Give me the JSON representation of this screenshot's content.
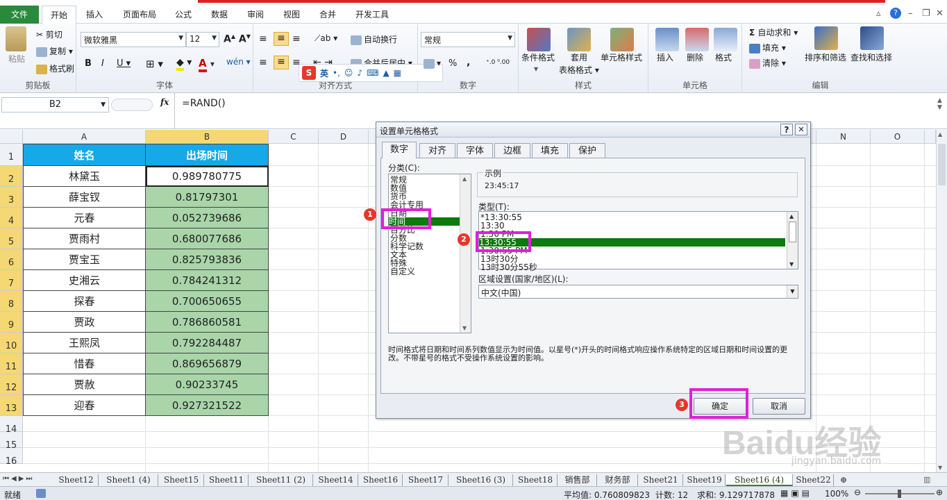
{
  "tabs": [
    "文件",
    "开始",
    "插入",
    "页面布局",
    "公式",
    "数据",
    "审阅",
    "视图",
    "合并",
    "开发工具"
  ],
  "ribbon": {
    "clipboard": {
      "paste": "粘贴",
      "cut": "剪切",
      "copy": "复制",
      "format_painter": "格式刷",
      "label": "剪贴板"
    },
    "font": {
      "name": "微软雅黑",
      "size": "12",
      "label": "字体",
      "bold": "B",
      "italic": "I",
      "underline": "U"
    },
    "align": {
      "wrap": "自动换行",
      "merge": "合并后居中",
      "label": "对齐方式"
    },
    "number": {
      "format": "常规",
      "label": "数字",
      "percent": "%",
      "comma": ","
    },
    "styles": {
      "cond": "条件格式",
      "table1": "套用",
      "table2": "表格格式",
      "cellstyle": "单元格样式",
      "label": "样式"
    },
    "cells": {
      "insert": "插入",
      "delete": "删除",
      "format": "格式",
      "label": "单元格"
    },
    "edit": {
      "autosum": "自动求和",
      "fill": "填充",
      "clear": "清除",
      "sort": "排序和筛选",
      "find": "查找和选择",
      "label": "编辑"
    },
    "ime": {
      "lang": "英"
    }
  },
  "formula": {
    "cell": "B2",
    "fx": "fx",
    "value": "=RAND()"
  },
  "columns": [
    "A",
    "B",
    "C",
    "D",
    "N",
    "O"
  ],
  "rows": [
    "1",
    "2",
    "3",
    "4",
    "5",
    "6",
    "7",
    "8",
    "9",
    "10",
    "11",
    "12",
    "13",
    "14",
    "15",
    "16"
  ],
  "header": {
    "name": "姓名",
    "time": "出场时间"
  },
  "data": [
    {
      "name": "林黛玉",
      "val": "0.989780775"
    },
    {
      "name": "薛宝钗",
      "val": "0.81797301"
    },
    {
      "name": "元春",
      "val": "0.052739686"
    },
    {
      "name": "贾雨村",
      "val": "0.680077686"
    },
    {
      "name": "贾宝玉",
      "val": "0.825793836"
    },
    {
      "name": "史湘云",
      "val": "0.784241312"
    },
    {
      "name": "探春",
      "val": "0.700650655"
    },
    {
      "name": "贾政",
      "val": "0.786860581"
    },
    {
      "name": "王熙凤",
      "val": "0.792284487"
    },
    {
      "name": "惜春",
      "val": "0.869656879"
    },
    {
      "name": "贾赦",
      "val": "0.90233745"
    },
    {
      "name": "迎春",
      "val": "0.927321522"
    }
  ],
  "dialog": {
    "title": "设置单元格格式",
    "help": "?",
    "close": "✕",
    "tabs": [
      "数字",
      "对齐",
      "字体",
      "边框",
      "填充",
      "保护"
    ],
    "category_label": "分类(C):",
    "categories": [
      "常规",
      "数值",
      "货币",
      "会计专用",
      "日期",
      "时间",
      "百分比",
      "分数",
      "科学记数",
      "文本",
      "特殊",
      "自定义"
    ],
    "selected_category": "时间",
    "sample_label": "示例",
    "sample": "23:45:17",
    "type_label": "类型(T):",
    "types": [
      "*13:30:55",
      "13:30",
      "1:30 PM",
      "13:30:55",
      "1:30:55 PM",
      "13时30分",
      "13时30分55秒"
    ],
    "selected_type": "13:30:55",
    "locale_label": "区域设置(国家/地区)(L):",
    "locale": "中文(中国)",
    "description": "时间格式将日期和时间系列数值显示为时间值。以星号(*)开头的时间格式响应操作系统特定的区域日期和时间设置的更改。不带星号的格式不受操作系统设置的影响。",
    "ok": "确定",
    "cancel": "取消",
    "badges": [
      "1",
      "2",
      "3"
    ]
  },
  "sheets": [
    "Sheet12",
    "Sheet1 (4)",
    "Sheet15",
    "Sheet11",
    "Sheet11 (2)",
    "Sheet14",
    "Sheet16",
    "Sheet17",
    "Sheet16 (3)",
    "Sheet18",
    "销售部",
    "财务部",
    "Sheet21",
    "Sheet19",
    "Sheet16 (4)",
    "Sheet22"
  ],
  "active_sheet": "Sheet16 (4)",
  "status": {
    "ready": "就绪",
    "avg": "平均值: 0.760809823",
    "count": "计数: 12",
    "sum": "求和: 9.129717878",
    "zoom": "100%"
  },
  "watermark": {
    "brand": "Baidu经验",
    "url": "jingyan.baidu.com"
  },
  "colors": {
    "header_blue": "#17a8e8",
    "cell_green": "#a9d5a9",
    "highlight": "#e020d8",
    "select_green": "#0d7a0d"
  }
}
